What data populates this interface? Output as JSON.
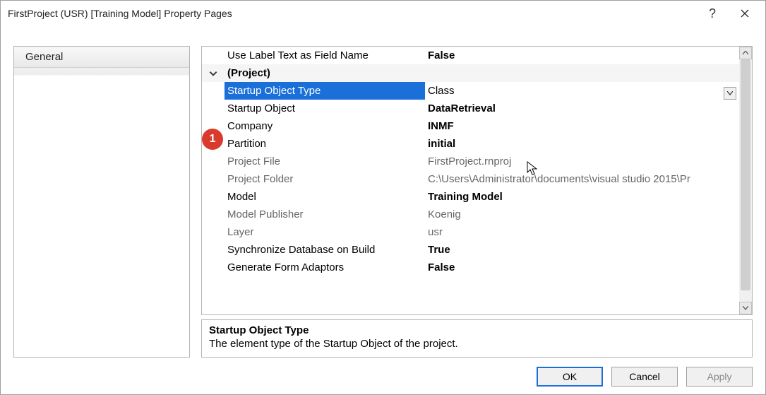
{
  "window": {
    "title": "FirstProject (USR) [Training Model] Property Pages",
    "help_label": "?",
    "close_label": "×"
  },
  "sidebar": {
    "items": [
      "General"
    ]
  },
  "grid": {
    "rows": [
      {
        "kind": "row",
        "label": "Use Label Text as Field Name",
        "value": "False",
        "bold_value": true
      },
      {
        "kind": "group",
        "label": "(Project)"
      },
      {
        "kind": "row",
        "label": "Startup Object Type",
        "value": "Class",
        "selected": true,
        "dropdown": true
      },
      {
        "kind": "row",
        "label": "Startup Object",
        "value": "DataRetrieval",
        "bold_value": true
      },
      {
        "kind": "row",
        "label": "Company",
        "value": "INMF",
        "bold_value": true
      },
      {
        "kind": "row",
        "label": "Partition",
        "value": "initial",
        "bold_value": true
      },
      {
        "kind": "row",
        "label": "Project File",
        "value": "FirstProject.rnproj",
        "readonly": true
      },
      {
        "kind": "row",
        "label": "Project Folder",
        "value": "C:\\Users\\Administrator\\documents\\visual studio 2015\\Pr",
        "readonly": true
      },
      {
        "kind": "row",
        "label": "Model",
        "value": "Training Model",
        "bold_value": true
      },
      {
        "kind": "row",
        "label": "Model Publisher",
        "value": "Koenig",
        "readonly": true
      },
      {
        "kind": "row",
        "label": "Layer",
        "value": "usr",
        "readonly": true
      },
      {
        "kind": "row",
        "label": "Synchronize Database on Build",
        "value": "True",
        "bold_value": true
      },
      {
        "kind": "row",
        "label": "Generate Form Adaptors",
        "value": "False",
        "bold_value": true
      }
    ]
  },
  "description": {
    "title": "Startup Object Type",
    "text": "The element type of the Startup Object of the project."
  },
  "buttons": {
    "ok": "OK",
    "cancel": "Cancel",
    "apply": "Apply"
  },
  "callout": "1"
}
